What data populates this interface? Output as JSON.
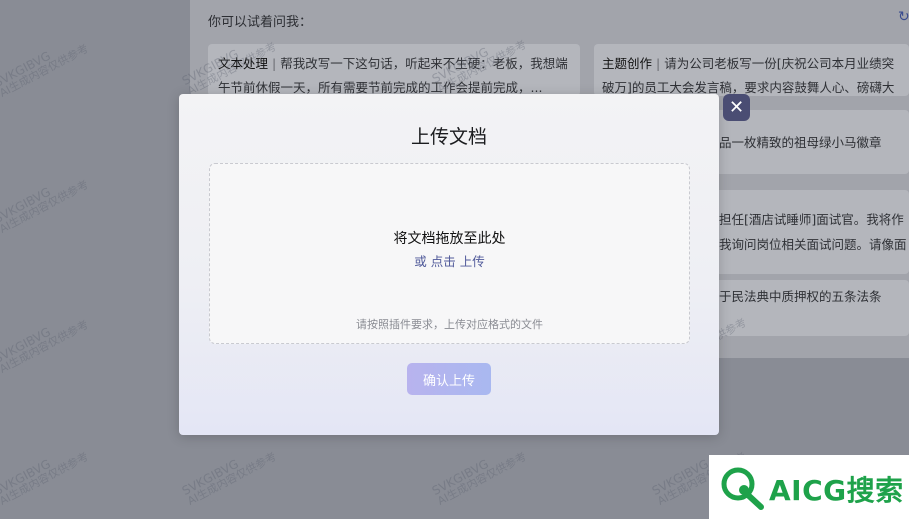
{
  "background": {
    "prompt_title": "你可以试着问我：",
    "cards": [
      {
        "tag": "文本处理",
        "text": "帮我改写一下这句话，听起来不生硬：老板，我想端午节前休假一天，所有需要节前完成的工作会提前完成，..."
      },
      {
        "tag": "主题创作",
        "text": "请为公司老板写一份[庆祝公司本月业绩突破万]的员工大会发言稿，要求内容鼓舞人心、磅礴大气..."
      }
    ],
    "right_lines": [
      "品一枚精致的祖母绿小马徽章",
      "担任[酒店试睡师]面试官。我将作",
      "我询问岗位相关面试问题。请像面",
      "于民法典中质押权的五条法条"
    ],
    "watermark": [
      "SVKGIBVG",
      "AI生成内容仅供参考"
    ]
  },
  "modal": {
    "title": "上传文档",
    "drop_main": "将文档拖放至此处",
    "drop_sub": "或 点击 上传",
    "drop_hint": "请按照插件要求，上传对应格式的文件",
    "confirm_label": "确认上传",
    "close_label": "✕"
  },
  "logo": {
    "text": "AICG搜索"
  },
  "colors": {
    "brand_green": "#1ea24a",
    "accent": "#505a9a",
    "close_bg": "#4a4d73"
  }
}
